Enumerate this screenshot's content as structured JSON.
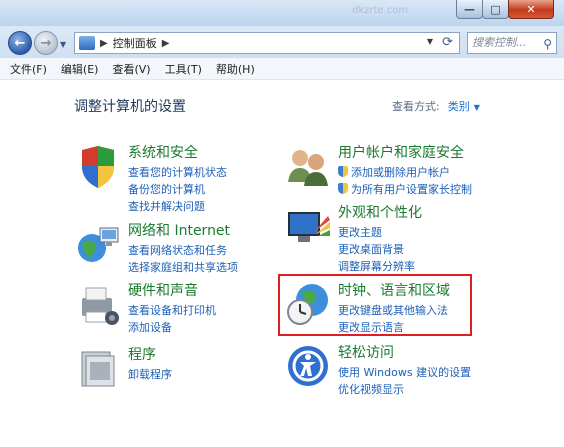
{
  "window": {
    "watermark": "dkzrte.com",
    "minimize": "—",
    "maximize": "□",
    "close": "✕"
  },
  "address": {
    "path": "控制面板",
    "search_placeholder": "搜索控制...",
    "search_icon": "search-icon"
  },
  "menu": [
    "文件(F)",
    "编辑(E)",
    "查看(V)",
    "工具(T)",
    "帮助(H)"
  ],
  "page": {
    "title": "调整计算机的设置",
    "view_by_label": "查看方式:",
    "view_by_value": "类别"
  },
  "categories": [
    {
      "title": "系统和安全",
      "icon": "shield-icon",
      "links": [
        "查看您的计算机状态",
        "备份您的计算机",
        "查找并解决问题"
      ]
    },
    {
      "title": "网络和 Internet",
      "icon": "network-icon",
      "links": [
        "查看网络状态和任务",
        "选择家庭组和共享选项"
      ]
    },
    {
      "title": "硬件和声音",
      "icon": "printer-icon",
      "links": [
        "查看设备和打印机",
        "添加设备"
      ]
    },
    {
      "title": "程序",
      "icon": "programs-icon",
      "links": [
        "卸载程序"
      ]
    },
    {
      "title": "用户帐户和家庭安全",
      "icon": "users-icon",
      "links": [
        "添加或删除用户帐户",
        "为所有用户设置家长控制"
      ]
    },
    {
      "title": "外观和个性化",
      "icon": "display-icon",
      "links": [
        "更改主题",
        "更改桌面背景",
        "调整屏幕分辨率"
      ]
    },
    {
      "title": "时钟、语言和区域",
      "icon": "clock-globe-icon",
      "links": [
        "更改键盘或其他输入法",
        "更改显示语言"
      ]
    },
    {
      "title": "轻松访问",
      "icon": "ease-of-access-icon",
      "links": [
        "使用 Windows 建议的设置",
        "优化视频显示"
      ]
    }
  ],
  "colors": {
    "category_title": "#1a7a2e",
    "link": "#1c5fb8",
    "highlight_box": "#e02020",
    "close_button": "#c4391c"
  }
}
